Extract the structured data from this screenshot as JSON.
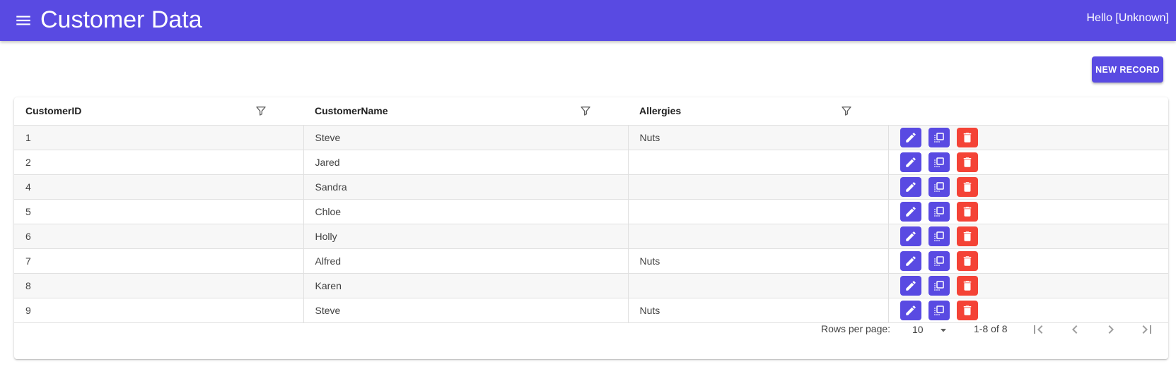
{
  "app": {
    "title": "Customer Data",
    "greeting": "Hello [Unknown]",
    "menu_icon": "menu-icon"
  },
  "toolbar": {
    "new_record_label": "NEW RECORD"
  },
  "table": {
    "columns": [
      {
        "label": "CustomerID"
      },
      {
        "label": "CustomerName"
      },
      {
        "label": "Allergies"
      }
    ],
    "rows": [
      {
        "id": "1",
        "name": "Steve",
        "allergies": "Nuts"
      },
      {
        "id": "2",
        "name": "Jared",
        "allergies": ""
      },
      {
        "id": "4",
        "name": "Sandra",
        "allergies": ""
      },
      {
        "id": "5",
        "name": "Chloe",
        "allergies": ""
      },
      {
        "id": "6",
        "name": "Holly",
        "allergies": ""
      },
      {
        "id": "7",
        "name": "Alfred",
        "allergies": "Nuts"
      },
      {
        "id": "8",
        "name": "Karen",
        "allergies": ""
      },
      {
        "id": "9",
        "name": "Steve",
        "allergies": "Nuts"
      }
    ]
  },
  "pagination": {
    "rows_per_page_label": "Rows per page:",
    "rows_per_page_value": "10",
    "range": "1-8 of 8"
  },
  "colors": {
    "primary": "#594ae2",
    "danger": "#f44336",
    "row_stripe": "#f7f7f7"
  },
  "icons": {
    "row_actions": [
      "edit-icon",
      "copy-icon",
      "delete-icon"
    ],
    "pager": [
      "first-page-icon",
      "previous-page-icon",
      "next-page-icon",
      "last-page-icon"
    ]
  }
}
